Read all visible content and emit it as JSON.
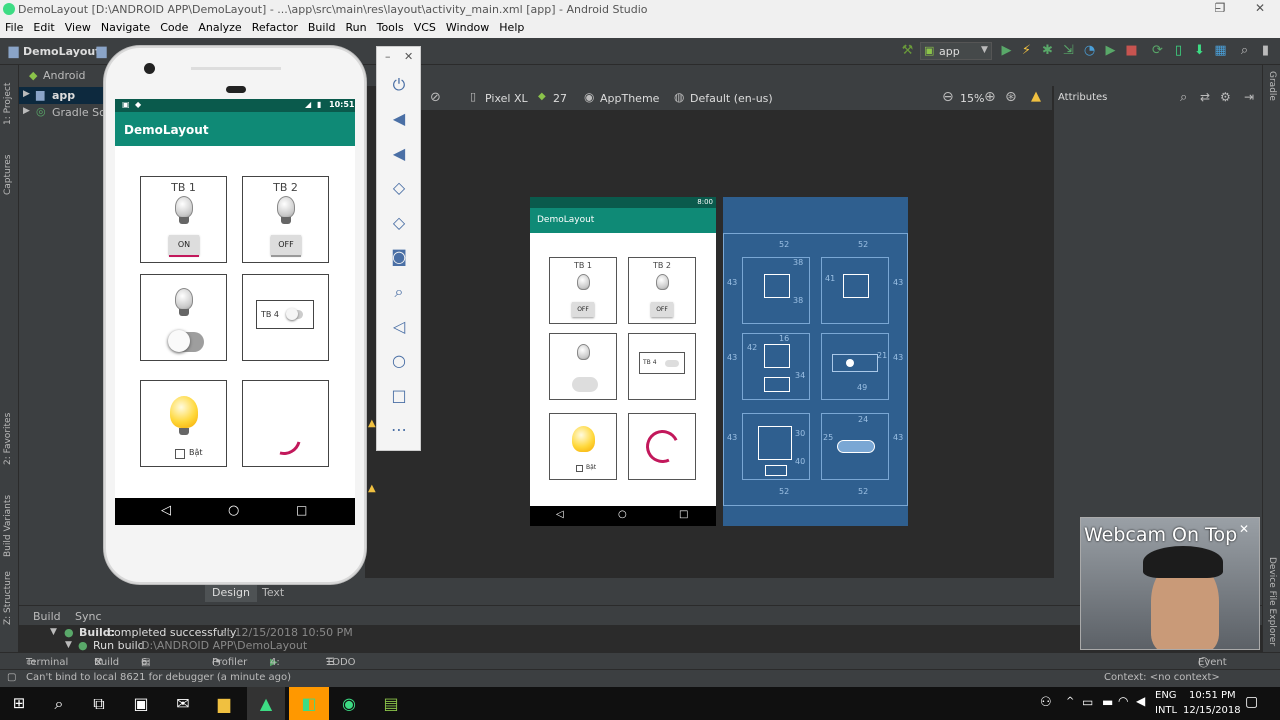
{
  "window": {
    "title": "DemoLayout [D:\\ANDROID APP\\DemoLayout] - ...\\app\\src\\main\\res\\layout\\activity_main.xml [app] - Android Studio",
    "minimize": "–",
    "maximize": "❐",
    "close": "✕"
  },
  "menu": [
    "File",
    "Edit",
    "View",
    "Navigate",
    "Code",
    "Analyze",
    "Refactor",
    "Build",
    "Run",
    "Tools",
    "VCS",
    "Window",
    "Help"
  ],
  "nav": {
    "project": "DemoLayout",
    "module": "app",
    "run_config": "app"
  },
  "project_panel": {
    "view": "Android",
    "items": [
      "app",
      "Gradle Scripts"
    ]
  },
  "left_strip": [
    "1: Project",
    "Captures",
    "2: Favorites",
    "Build Variants",
    "Z: Structure"
  ],
  "right_strip": [
    "Gradle",
    "Device File Explorer"
  ],
  "editor_toolbar": {
    "device": "Pixel XL",
    "api": "27",
    "theme": "AppTheme",
    "locale": "Default (en-us)",
    "zoom": "15%"
  },
  "attributes_title": "Attributes",
  "phone": {
    "time": "10:51",
    "app_title": "DemoLayout",
    "cells": {
      "tb1_label": "TB 1",
      "tb1_button": "ON",
      "tb2_label": "TB 2",
      "tb2_button": "OFF",
      "tb4_label": "TB 4",
      "checkbox_label": "Bật"
    }
  },
  "preview": {
    "time": "8:00",
    "app_title": "DemoLayout",
    "tb1": "TB 1",
    "tb2": "TB 2",
    "tb4": "TB 4",
    "btn_off": "OFF",
    "check": "Bật"
  },
  "blueprint": {
    "margins": [
      "52",
      "52",
      "43",
      "43",
      "38",
      "38",
      "41",
      "43",
      "16",
      "42",
      "43",
      "21",
      "34",
      "49",
      "43",
      "43",
      "24",
      "25",
      "30",
      "40",
      "52",
      "52"
    ]
  },
  "design_tabs": {
    "design": "Design",
    "text": "Text"
  },
  "build_panel": {
    "tabs": [
      "Build",
      "Sync"
    ],
    "line1_label": "Build:",
    "line1_status": "completed successfully",
    "line1_time": "at 12/15/2018 10:50 PM",
    "line2_label": "Run build",
    "line2_path": "D:\\ANDROID APP\\DemoLayout"
  },
  "bottom_tabs": [
    "Terminal",
    "Build",
    "6: Logcat",
    "Profiler",
    "4: Run",
    "TODO"
  ],
  "event_log": "Event Log",
  "status": {
    "message": "Can't bind to local 8621 for debugger (a minute ago)",
    "context": "Context: <no context>"
  },
  "webcam": {
    "title": "Webcam On Top"
  },
  "taskbar": {
    "lang_top": "ENG",
    "lang_bottom": "INTL",
    "time": "10:51 PM",
    "date": "12/15/2018"
  },
  "colors": {
    "app_bar": "#0f8a76",
    "status_bar": "#0a5a4c",
    "accent": "#c2185b",
    "blueprint": "#2f5f8f",
    "ide_bg": "#3c3f41"
  }
}
